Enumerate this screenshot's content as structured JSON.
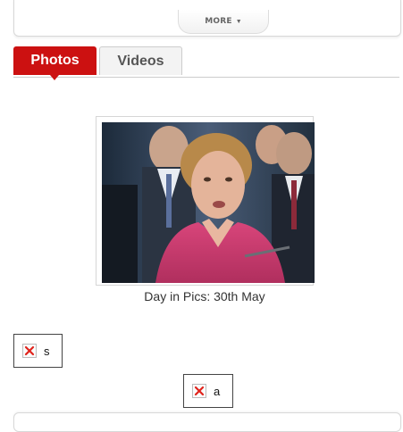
{
  "header": {
    "more_label": "MORE"
  },
  "tabs": [
    {
      "label": "Photos",
      "active": true
    },
    {
      "label": "Videos",
      "active": false
    }
  ],
  "photo": {
    "caption": "Day in Pics: 30th May"
  },
  "broken_images": [
    {
      "alt": "s",
      "icon": "broken-image-icon"
    },
    {
      "alt": "a",
      "icon": "broken-image-icon"
    }
  ],
  "colors": {
    "accent": "#cc1111",
    "inactive_tab_bg": "#f3f3f3",
    "broken_x": "#e0231b"
  }
}
